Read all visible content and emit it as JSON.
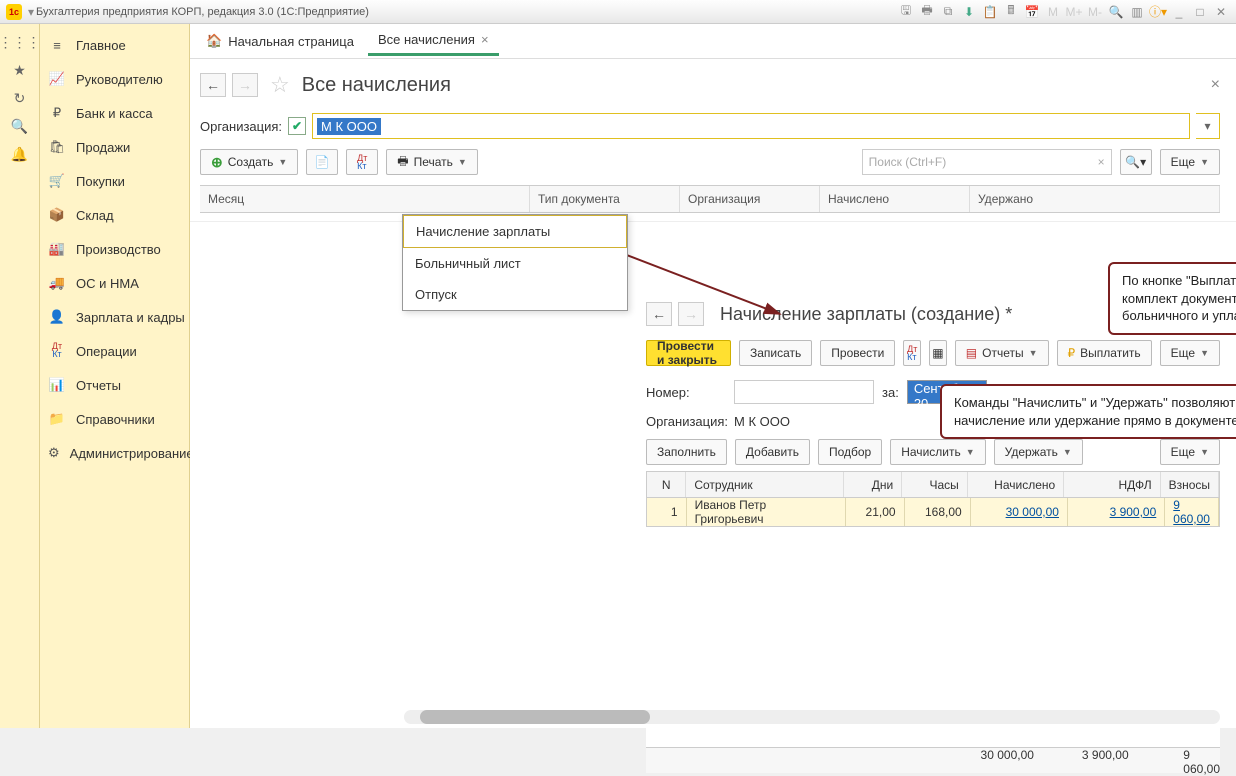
{
  "window": {
    "title": "Бухгалтерия предприятия КОРП, редакция 3.0  (1С:Предприятие)"
  },
  "sidebar": {
    "items": [
      {
        "icon": "≡",
        "label": "Главное"
      },
      {
        "icon": "↗",
        "label": "Руководителю"
      },
      {
        "icon": "₽",
        "label": "Банк и касса"
      },
      {
        "icon": "🛒",
        "label": "Продажи"
      },
      {
        "icon": "🛒",
        "label": "Покупки"
      },
      {
        "icon": "📦",
        "label": "Склад"
      },
      {
        "icon": "🏭",
        "label": "Производство"
      },
      {
        "icon": "🚚",
        "label": "ОС и НМА"
      },
      {
        "icon": "👤",
        "label": "Зарплата и кадры"
      },
      {
        "icon": "Дт",
        "label": "Операции"
      },
      {
        "icon": "📊",
        "label": "Отчеты"
      },
      {
        "icon": "📁",
        "label": "Справочники"
      },
      {
        "icon": "⚙",
        "label": "Администрирование"
      }
    ]
  },
  "tabs": {
    "home": "Начальная страница",
    "active": "Все начисления"
  },
  "page": {
    "title": "Все начисления",
    "org_label": "Организация:",
    "org_value": "М К ООО",
    "create": "Создать",
    "print": "Печать",
    "search_placeholder": "Поиск (Ctrl+F)",
    "more": "Еще",
    "columns": [
      "Месяц",
      "Тип документа",
      "Организация",
      "Начислено",
      "Удержано"
    ]
  },
  "dropdown": {
    "items": [
      "Начисление зарплаты",
      "Больничный лист",
      "Отпуск"
    ]
  },
  "sub": {
    "title": "Начисление зарплаты (создание) *",
    "post_close": "Провести и закрыть",
    "write": "Записать",
    "post": "Провести",
    "reports": "Отчеты",
    "pay": "Выплатить",
    "more": "Еще",
    "num_label": "Номер:",
    "za": "за:",
    "period": "Сентябрь 20",
    "org_label": "Организация:",
    "org_value": "М К ООО",
    "fill": "Заполнить",
    "add": "Добавить",
    "pick": "Подбор",
    "accrue": "Начислить",
    "deduct": "Удержать",
    "cols": [
      "N",
      "Сотрудник",
      "Дни",
      "Часы",
      "Начислено",
      "НДФЛ",
      "Взносы"
    ],
    "row": {
      "n": "1",
      "emp": "Иванов Петр Григорьевич",
      "days": "21,00",
      "hours": "168,00",
      "acc": "30 000,00",
      "ndfl": "3 900,00",
      "contr": "9 060,00"
    },
    "totals": {
      "acc": "30 000,00",
      "ndfl": "3 900,00",
      "contr": "9 060,00"
    }
  },
  "callouts": {
    "c1": "По кнопке \"Выплатить\" формируется комплект документов на выплату больничного и уплату НДФЛ",
    "c2": "Команды \"Начислить\" и \"Удержать\" позволяют сделать любое начисление или удержание прямо в документе"
  }
}
